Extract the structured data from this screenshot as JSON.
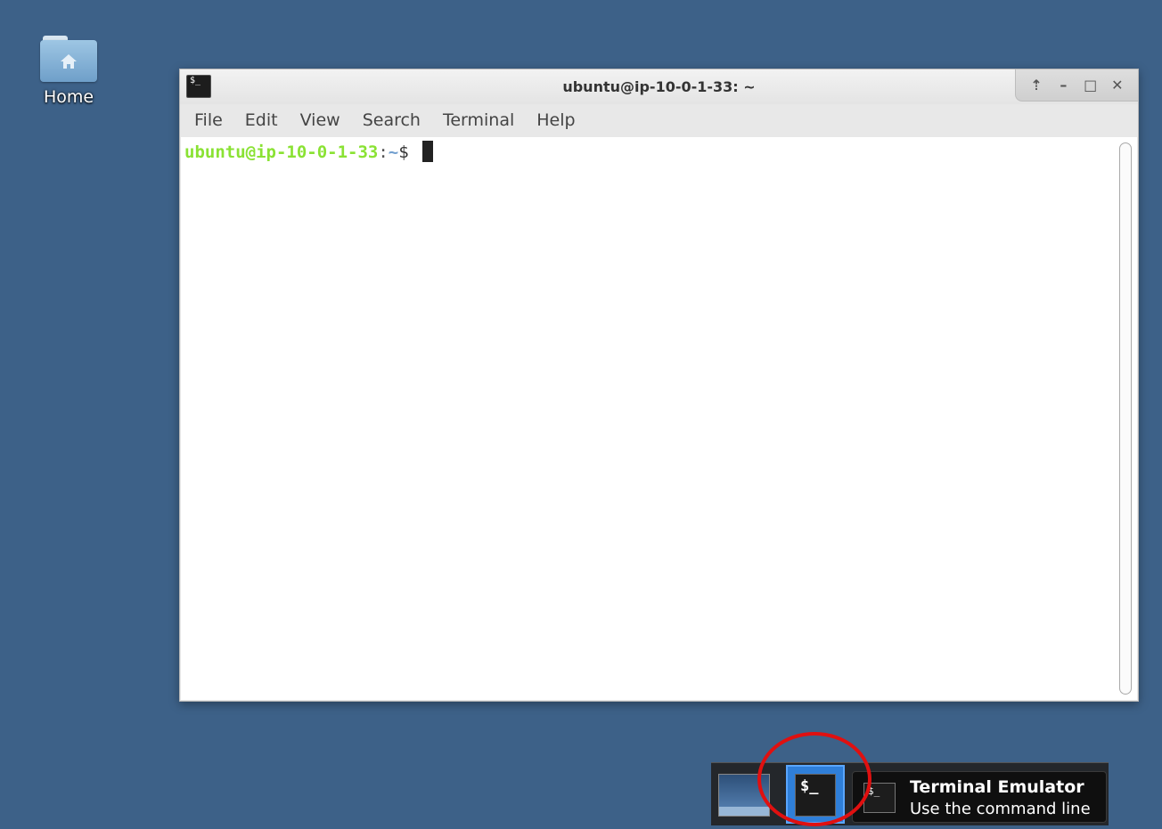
{
  "desktop": {
    "home_icon_label": "Home"
  },
  "window": {
    "title": "ubuntu@ip-10-0-1-33: ~",
    "app_icon_glyph": "$_",
    "buttons": {
      "up": "⇡",
      "minimize": "–",
      "maximize": "□",
      "close": "✕"
    },
    "menu": [
      "File",
      "Edit",
      "View",
      "Search",
      "Terminal",
      "Help"
    ]
  },
  "terminal": {
    "prompt_user": "ubuntu@ip-10-0-1-33",
    "prompt_colon": ":",
    "prompt_path": "~",
    "prompt_symbol": "$ "
  },
  "dock": {
    "terminal_glyph": "$_"
  },
  "tooltip": {
    "icon_glyph": "$_",
    "title": "Terminal Emulator",
    "subtitle": "Use the command line"
  },
  "colors": {
    "desktop_bg": "#3d6188",
    "prompt_user": "#8ae234",
    "prompt_path": "#729fcf",
    "dock_active": "#2f7fd9",
    "annotation": "#e01010"
  }
}
